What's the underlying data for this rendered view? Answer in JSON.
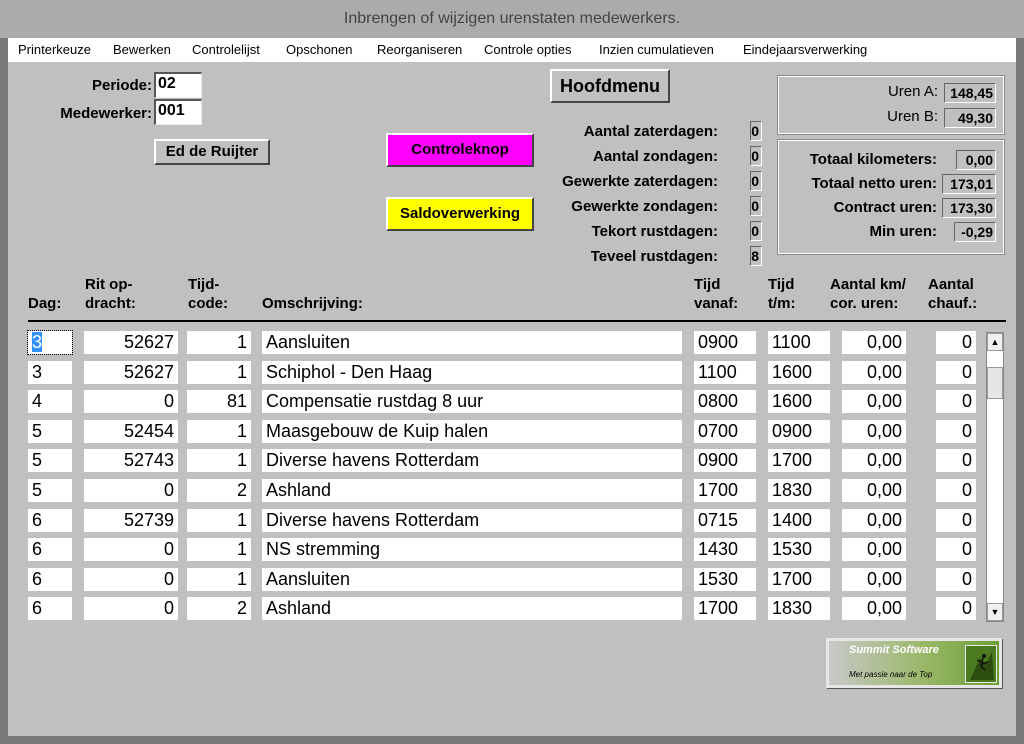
{
  "window": {
    "title": "Inbrengen of wijzigen urenstaten medewerkers."
  },
  "menu": [
    "Printerkeuze",
    "Bewerken",
    "Controlelijst",
    "Opschonen",
    "Reorganiseren",
    "Controle opties",
    "Inzien cumulatieven",
    "Eindejaarsverwerking"
  ],
  "form": {
    "periode_label": "Periode:",
    "periode_value": "02",
    "medewerker_label": "Medewerker:",
    "medewerker_value": "001",
    "employee_name": "Ed de Ruijter",
    "hoofdmenu": "Hoofdmenu",
    "controleknop": "Controleknop",
    "saldoverwerking": "Saldoverwerking"
  },
  "stats": [
    {
      "label": "Aantal zaterdagen:",
      "value": "0"
    },
    {
      "label": "Aantal zondagen:",
      "value": "0"
    },
    {
      "label": "Gewerkte zaterdagen:",
      "value": "0"
    },
    {
      "label": "Gewerkte zondagen:",
      "value": "0"
    },
    {
      "label": "Tekort rustdagen:",
      "value": "0"
    },
    {
      "label": "Teveel rustdagen:",
      "value": "8"
    }
  ],
  "uren": [
    {
      "label": "Uren A:",
      "value": "148,45"
    },
    {
      "label": "Uren B:",
      "value": "49,30"
    }
  ],
  "totals": [
    {
      "label": "Totaal kilometers:",
      "value": "0,00"
    },
    {
      "label": "Totaal netto uren:",
      "value": "173,01"
    },
    {
      "label": "Contract uren:",
      "value": "173,30"
    },
    {
      "label": "Min uren:",
      "value": "-0,29"
    }
  ],
  "table": {
    "headers": {
      "dag": "Dag:",
      "rit_1": "Rit op-",
      "rit_2": "dracht:",
      "tijd_1": "Tijd-",
      "tijd_2": "code:",
      "oms": "Omschrijving:",
      "vanaf_1": "Tijd",
      "vanaf_2": "vanaf:",
      "tm_1": "Tijd",
      "tm_2": "t/m:",
      "km_1": "Aantal km/",
      "km_2": "cor. uren:",
      "chauf_1": "Aantal",
      "chauf_2": "chauf.:"
    },
    "rows": [
      [
        "3",
        "52627",
        "1",
        "Aansluiten",
        "0900",
        "1100",
        "0,00",
        "0"
      ],
      [
        "3",
        "52627",
        "1",
        "Schiphol - Den Haag",
        "1100",
        "1600",
        "0,00",
        "0"
      ],
      [
        "4",
        "0",
        "81",
        "Compensatie rustdag 8 uur",
        "0800",
        "1600",
        "0,00",
        "0"
      ],
      [
        "5",
        "52454",
        "1",
        "Maasgebouw de Kuip halen",
        "0700",
        "0900",
        "0,00",
        "0"
      ],
      [
        "5",
        "52743",
        "1",
        "Diverse havens Rotterdam",
        "0900",
        "1700",
        "0,00",
        "0"
      ],
      [
        "5",
        "0",
        "2",
        "Ashland",
        "1700",
        "1830",
        "0,00",
        "0"
      ],
      [
        "6",
        "52739",
        "1",
        "Diverse havens Rotterdam",
        "0715",
        "1400",
        "0,00",
        "0"
      ],
      [
        "6",
        "0",
        "1",
        "NS stremming",
        "1430",
        "1530",
        "0,00",
        "0"
      ],
      [
        "6",
        "0",
        "1",
        "Aansluiten",
        "1530",
        "1700",
        "0,00",
        "0"
      ],
      [
        "6",
        "0",
        "2",
        "Ashland",
        "1700",
        "1830",
        "0,00",
        "0"
      ]
    ]
  },
  "logo": {
    "brand": "Summit Software",
    "tagline": "Met passie naar de Top"
  }
}
